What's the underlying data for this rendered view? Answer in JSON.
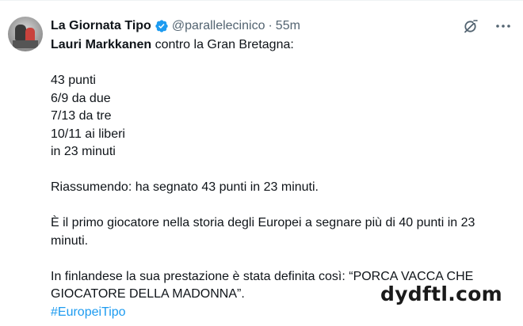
{
  "author": {
    "display_name": "La Giornata Tipo",
    "handle": "@parallelecinico",
    "separator": "·",
    "time": "55m",
    "verified_badge": "verified-badge-icon"
  },
  "tweet": {
    "lines": [
      {
        "bold": "Lauri Markkanen",
        "rest": " contro la Gran Bretagna:"
      },
      {
        "text": "43 punti"
      },
      {
        "text": "6/9 da due"
      },
      {
        "text": "7/13 da tre"
      },
      {
        "text": "10/11 ai liberi"
      },
      {
        "text": "in 23 minuti"
      },
      {
        "text": "Riassumendo: ha segnato 43 punti in 23 minuti."
      },
      {
        "text": "È il primo giocatore nella storia degli Europei a segnare più di 40 punti in 23 minuti."
      },
      {
        "text": "In finlandese la sua prestazione è stata definita così: “PORCA VACCA CHE GIOCATORE DELLA MADONNA”."
      }
    ],
    "hashtag": "#EuropeiTipo"
  },
  "watermark": "dydftl.com",
  "colors": {
    "text": "#0f1419",
    "muted": "#536471",
    "link": "#1d9bf0",
    "verified": "#1d9bf0"
  }
}
